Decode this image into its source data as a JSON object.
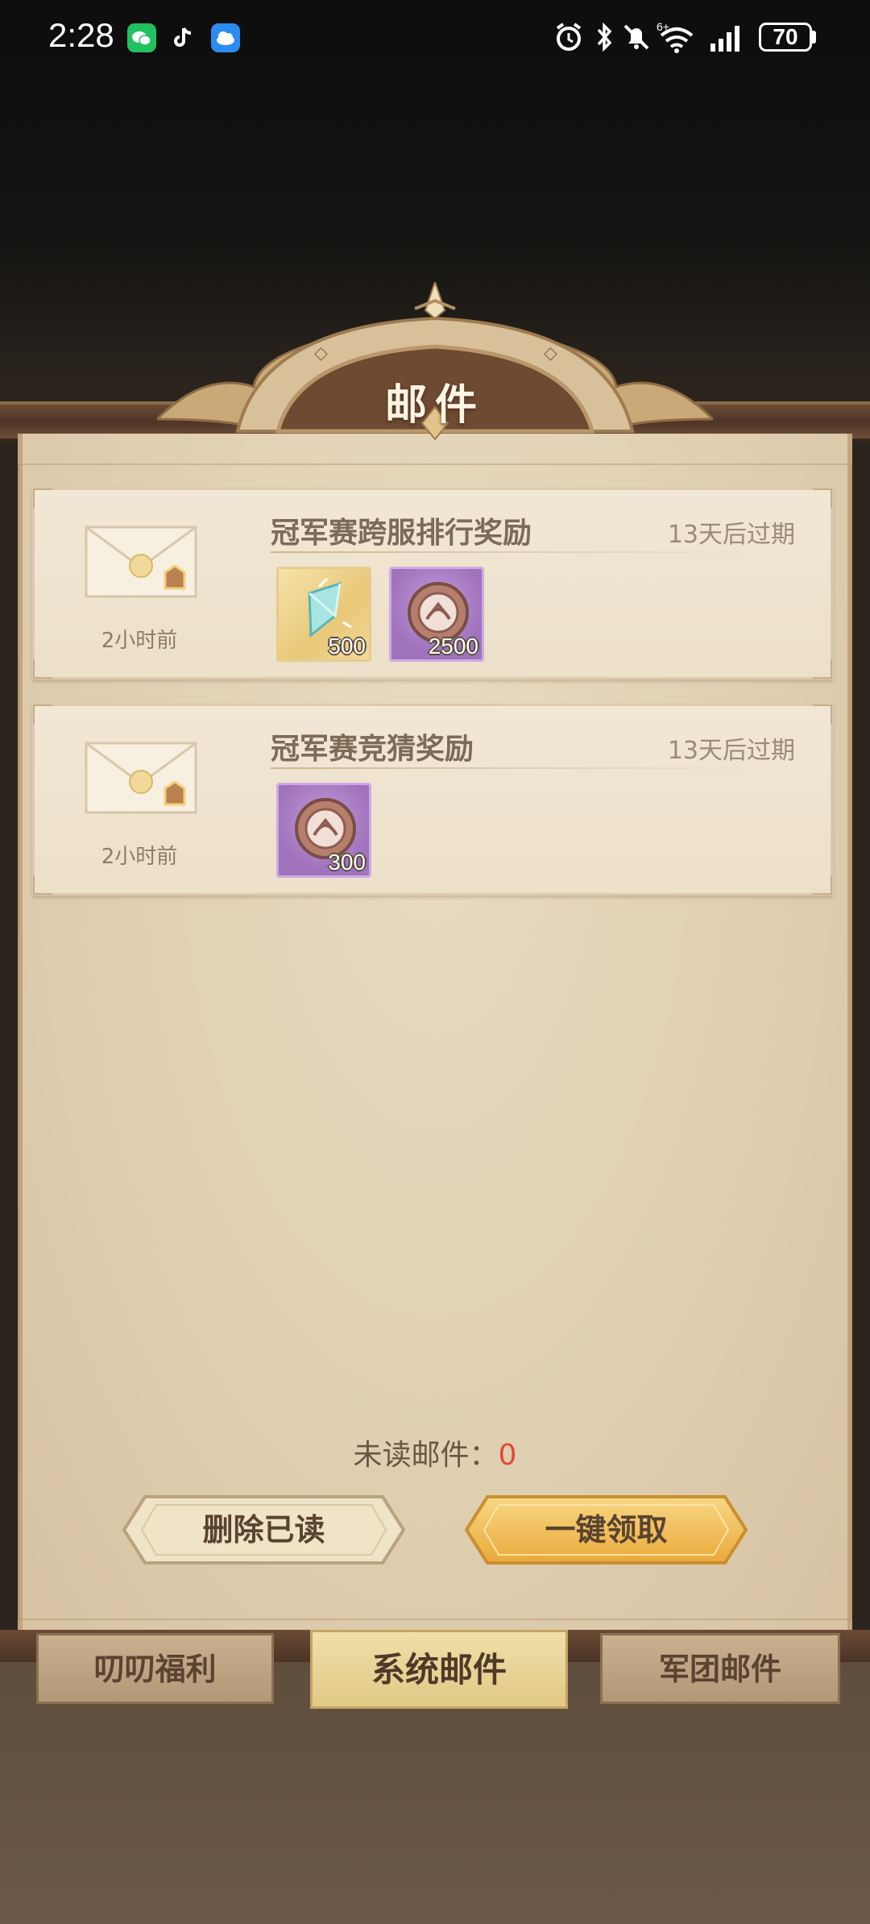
{
  "status_bar": {
    "time": "2:28",
    "battery": "70",
    "network": "6+"
  },
  "header": {
    "title": "邮件"
  },
  "mails": [
    {
      "title": "冠军赛跨服排行奖励",
      "expire": "13天后过期",
      "time": "2小时前",
      "items": [
        {
          "icon": "crystal-icon",
          "qty": "500"
        },
        {
          "icon": "coin-icon",
          "qty": "2500"
        }
      ]
    },
    {
      "title": "冠军赛竞猜奖励",
      "expire": "13天后过期",
      "time": "2小时前",
      "items": [
        {
          "icon": "coin-icon",
          "qty": "300"
        }
      ]
    }
  ],
  "footer": {
    "unread_label": "未读邮件：",
    "unread_count": "0",
    "delete_read_label": "删除已读",
    "claim_all_label": "一键领取"
  },
  "tabs": [
    {
      "label": "叨叨福利",
      "active": false
    },
    {
      "label": "系统邮件",
      "active": true
    },
    {
      "label": "军团邮件",
      "active": false
    }
  ],
  "colors": {
    "unread_count": "#e0493a",
    "claim_button": "#f0b84a",
    "delete_button": "#efe3c8"
  }
}
